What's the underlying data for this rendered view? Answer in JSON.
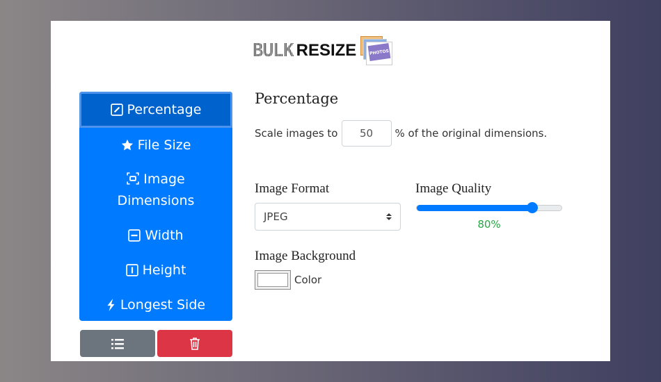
{
  "logo": {
    "part1": "BULK",
    "part2": "RESIZE",
    "badge": "PHOTOS"
  },
  "menu": [
    {
      "label": "Percentage",
      "icon": "pencil-square-icon",
      "active": true
    },
    {
      "label": "File Size",
      "icon": "star-icon"
    },
    {
      "label": "Image Dimensions",
      "icon": "crop-focus-icon"
    },
    {
      "label": "Width",
      "icon": "dash-square-icon"
    },
    {
      "label": "Height",
      "icon": "bar-square-icon"
    },
    {
      "label": "Longest Side",
      "icon": "lightning-icon"
    }
  ],
  "buttons": {
    "list_icon": "list-icon",
    "delete_icon": "trash-icon"
  },
  "main": {
    "title": "Percentage",
    "scale_prefix": "Scale images to",
    "scale_value": "50",
    "scale_suffix": "% of the original dimensions.",
    "format_label": "Image Format",
    "format_value": "JPEG",
    "quality_label": "Image Quality",
    "quality": {
      "value": 80,
      "text": "80%"
    },
    "background_label": "Image Background",
    "color_label": "Color",
    "color_value": "#ffffff"
  },
  "colors": {
    "primary": "#007bff",
    "active": "#0062cc",
    "danger": "#dc3545",
    "secondary": "#6c757d",
    "success": "#28a745"
  }
}
